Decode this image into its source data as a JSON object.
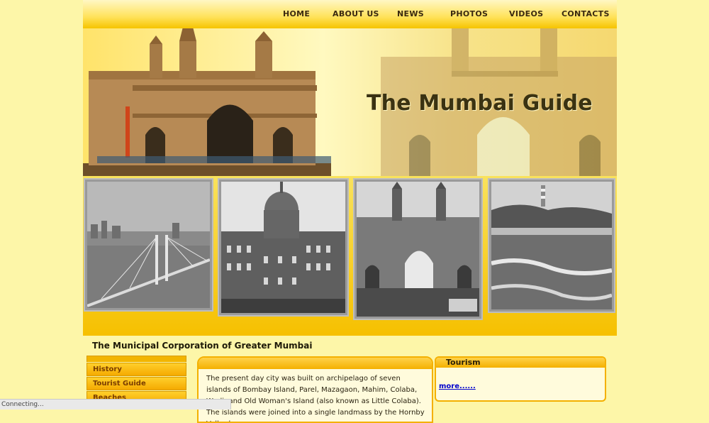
{
  "nav": {
    "items": [
      "HOME",
      "ABOUT US",
      "NEWS",
      "PHOTOS",
      "VIDEOS",
      "CONTACTS"
    ]
  },
  "banner": {
    "title": "The Mumbai Guide"
  },
  "photos": [
    {
      "subject": "sea-link-bridge"
    },
    {
      "subject": "taj-hotel"
    },
    {
      "subject": "gateway-of-india"
    },
    {
      "subject": "beach-lighthouse"
    }
  ],
  "content": {
    "heading": "The Municipal Corporation of Greater Mumbai",
    "sidebar": [
      "History",
      "Tourist Guide",
      "Beaches"
    ],
    "intro": "The present day city was built on archipelago of seven islands of Bombay Island, Parel, Mazagaon, Mahim, Colaba, Worli, and Old Woman's Island (also known as Little Colaba). The islands were joined into a single landmass by the Hornby Vellard",
    "tourism": {
      "title": "Tourism",
      "more": "more......"
    }
  },
  "status": {
    "text": "Connecting..."
  },
  "colors": {
    "accent": "#f4b000",
    "background": "#fdf6a8",
    "link": "#0000cc"
  }
}
